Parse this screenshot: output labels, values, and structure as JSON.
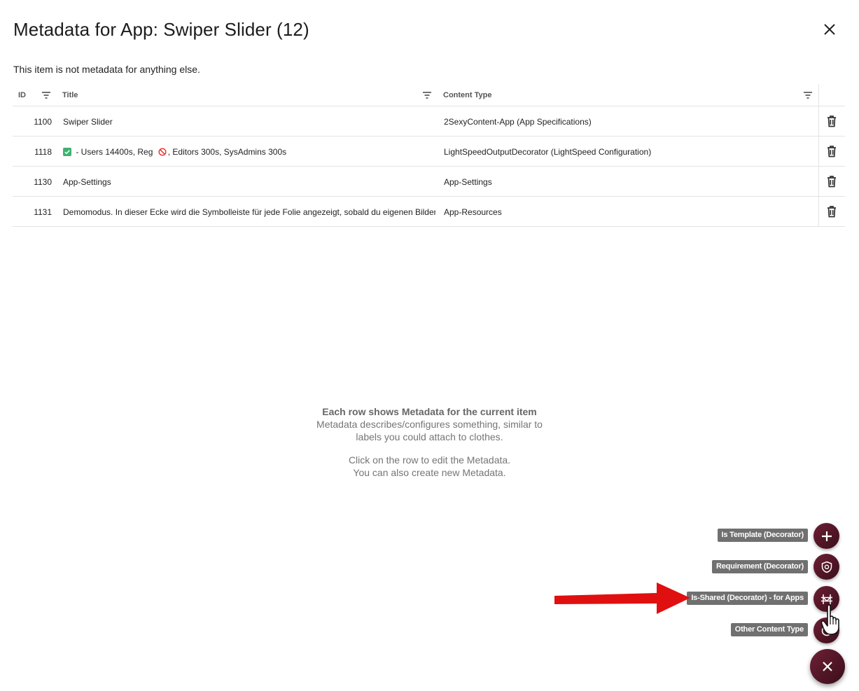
{
  "dialog": {
    "title": "Metadata for App: Swiper Slider (12)",
    "subtitle": "This item is not metadata for anything else."
  },
  "grid": {
    "columns": {
      "id": "ID",
      "title": "Title",
      "content_type": "Content Type"
    },
    "rows": [
      {
        "id": "1100",
        "title": "Swiper Slider",
        "content_type": "2SexyContent-App (App Specifications)"
      },
      {
        "id": "1118",
        "title_part1": " - Users 14400s, Reg ",
        "title_part2": ", Editors 300s, SysAdmins 300s",
        "content_type": "LightSpeedOutputDecorator (LightSpeed Configuration)"
      },
      {
        "id": "1130",
        "title": "App-Settings",
        "content_type": "App-Settings"
      },
      {
        "id": "1131",
        "title": "Demomodus. In dieser Ecke wird die Symbolleiste für jede Folie angezeigt, sobald du eigenen Bilder hi",
        "content_type": "App-Resources"
      }
    ]
  },
  "help": {
    "heading": "Each row shows Metadata for the current item",
    "line1": "Metadata describes/configures something, similar to",
    "line2": "labels you could attach to clothes.",
    "line3": "Click on the row to edit the Metadata.",
    "line4": "You can also create new Metadata."
  },
  "speed_dial": {
    "actions": [
      {
        "label": "Is Template (Decorator)",
        "icon": "plus-icon"
      },
      {
        "label": "Requirement (Decorator)",
        "icon": "shield-icon"
      },
      {
        "label": "Is-Shared (Decorator) - for Apps",
        "icon": "share-network-icon"
      },
      {
        "label": "Other Content Type",
        "icon": "add-circle-icon"
      }
    ],
    "main_icon": "close-icon"
  },
  "colors": {
    "fab": "#4d1526",
    "label_bg": "#707070",
    "arrow": "#e01010",
    "check": "#3cb371",
    "ban": "#e53935"
  }
}
